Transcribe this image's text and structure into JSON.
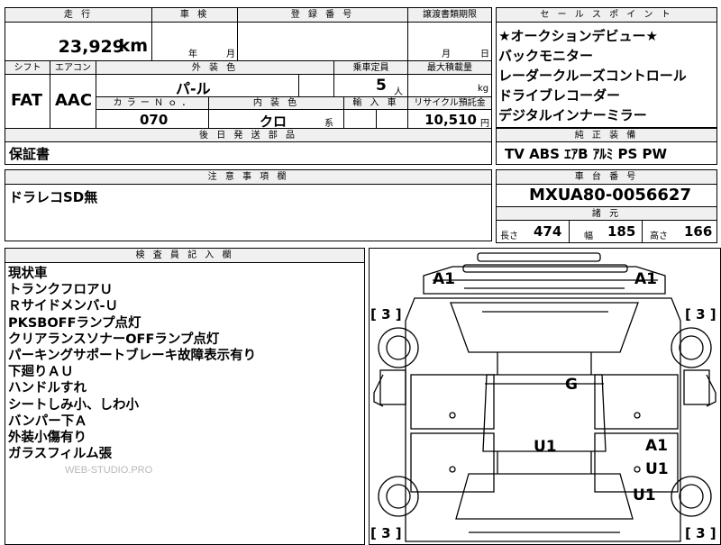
{
  "main": {
    "headers": {
      "mileage": "走 行",
      "inspection": "車 検",
      "registration": "登 録 番 号",
      "transfer_deadline": "譲渡書類期限",
      "shift": "シフト",
      "aircon": "エアコン",
      "exterior_color": "外 装 色",
      "capacity": "乗車定員",
      "max_load": "最大積載量",
      "color_no": "カ ラ ー Ｎ ｏ ．",
      "interior_color": "内 装 色",
      "import": "輸 入 車",
      "recycle": "リサイクル預託金"
    },
    "mileage_value": "23,929",
    "mileage_unit": "km",
    "inspection_year": "年",
    "inspection_month": "月",
    "transfer_month": "月",
    "transfer_day": "日",
    "shift_value": "FAT",
    "aircon_value": "AAC",
    "exterior_color_value": "パ-ル",
    "capacity_value": "5",
    "capacity_unit": "人",
    "max_load_unit": "kg",
    "color_no_value": "070",
    "interior_color_value": "クロ",
    "interior_color_suffix": "系",
    "recycle_value": "10,510",
    "recycle_unit": "円"
  },
  "sales_points": {
    "header": "セ ー ル ス ポ イ ン ト",
    "items": [
      "★オークションデビュー★",
      "バックモニター",
      "レーダークルーズコントロール",
      "ドライブレコーダー",
      "デジタルインナーミラー"
    ]
  },
  "later_parts": {
    "header": "後 日 発 送 部 品",
    "value": "保証書"
  },
  "genuine_equipment": {
    "header": "純 正 装 備",
    "value": "TV ABS ｴｱB ｱﾙﾐ PS PW"
  },
  "notes": {
    "header": "注 意 事 項 欄",
    "value": "ドラレコSD無"
  },
  "chassis": {
    "header": "車 台 番 号",
    "value": "MXUA80-0056627"
  },
  "dimensions": {
    "header": "諸 元",
    "length_label": "長さ",
    "length_value": "474",
    "width_label": "幅",
    "width_value": "185",
    "height_label": "高さ",
    "height_value": "166"
  },
  "inspector": {
    "header": "検 査 員 記 入 欄",
    "items": [
      "現状車",
      "トランクフロアＵ",
      "Ｒサイドメンバ-Ｕ",
      "PKSBOFFランプ点灯",
      "クリアランスソナーOFFランプ点灯",
      "パーキングサポートブレーキ故障表示有り",
      "下廻りＡＵ",
      "ハンドルすれ",
      "シートしみ小、しわ小",
      "バンパー下Ａ",
      "外装小傷有り",
      "ガラスフィルム張"
    ],
    "watermark": "WEB-STUDIO.PRO"
  },
  "diagram": {
    "marks": {
      "a1_top_left": "A1",
      "a1_top_right": "A1",
      "g_roof": "G",
      "u1_center": "U1",
      "a1_right_door": "A1",
      "u1_right_door": "U1",
      "u1_right_rear": "U1"
    },
    "tires": {
      "front_left": "[ 3 ]",
      "front_right": "[ 3 ]",
      "rear_left": "[ 3 ]",
      "rear_right": "[ 3 ]"
    }
  }
}
